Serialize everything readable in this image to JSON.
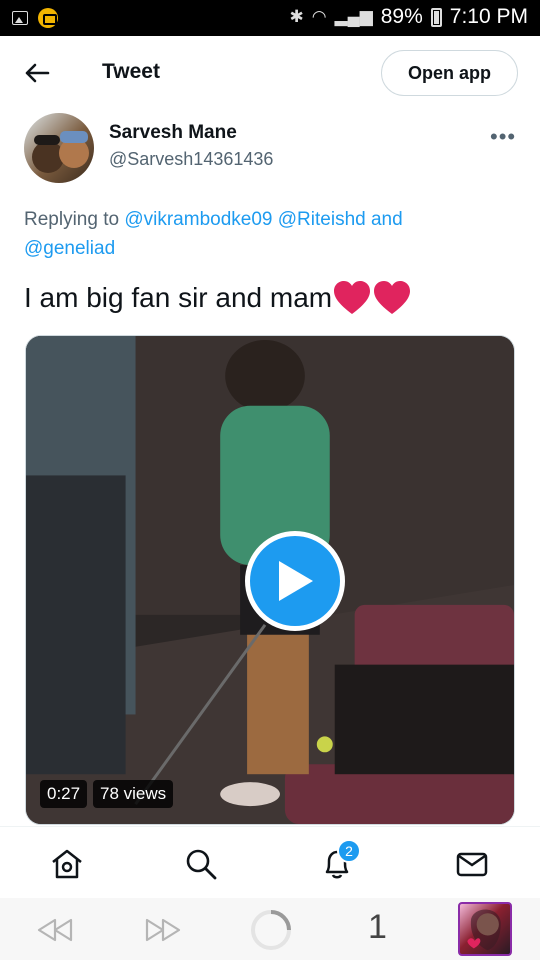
{
  "status_bar": {
    "battery": "89%",
    "time": "7:10 PM"
  },
  "header": {
    "title": "Tweet",
    "open_app_label": "Open app"
  },
  "tweet": {
    "author_name": "Sarvesh Mane",
    "author_handle": "@Sarvesh14361436",
    "reply_prefix": "Replying to",
    "reply_mention_1": "@vikrambodke09",
    "reply_mention_2": "@Riteishd",
    "reply_and": "and",
    "reply_mention_3": "@geneliad",
    "text": "I am big fan sir and mam",
    "heart_color": "#e0245e"
  },
  "video": {
    "duration": "0:27",
    "views": "78 views",
    "accent": "#1d9bf0"
  },
  "nav": {
    "items": [
      "home-icon",
      "search-icon",
      "notifications-icon",
      "messages-icon"
    ],
    "notification_count": "2"
  },
  "browser": {
    "tab_count": "1"
  }
}
